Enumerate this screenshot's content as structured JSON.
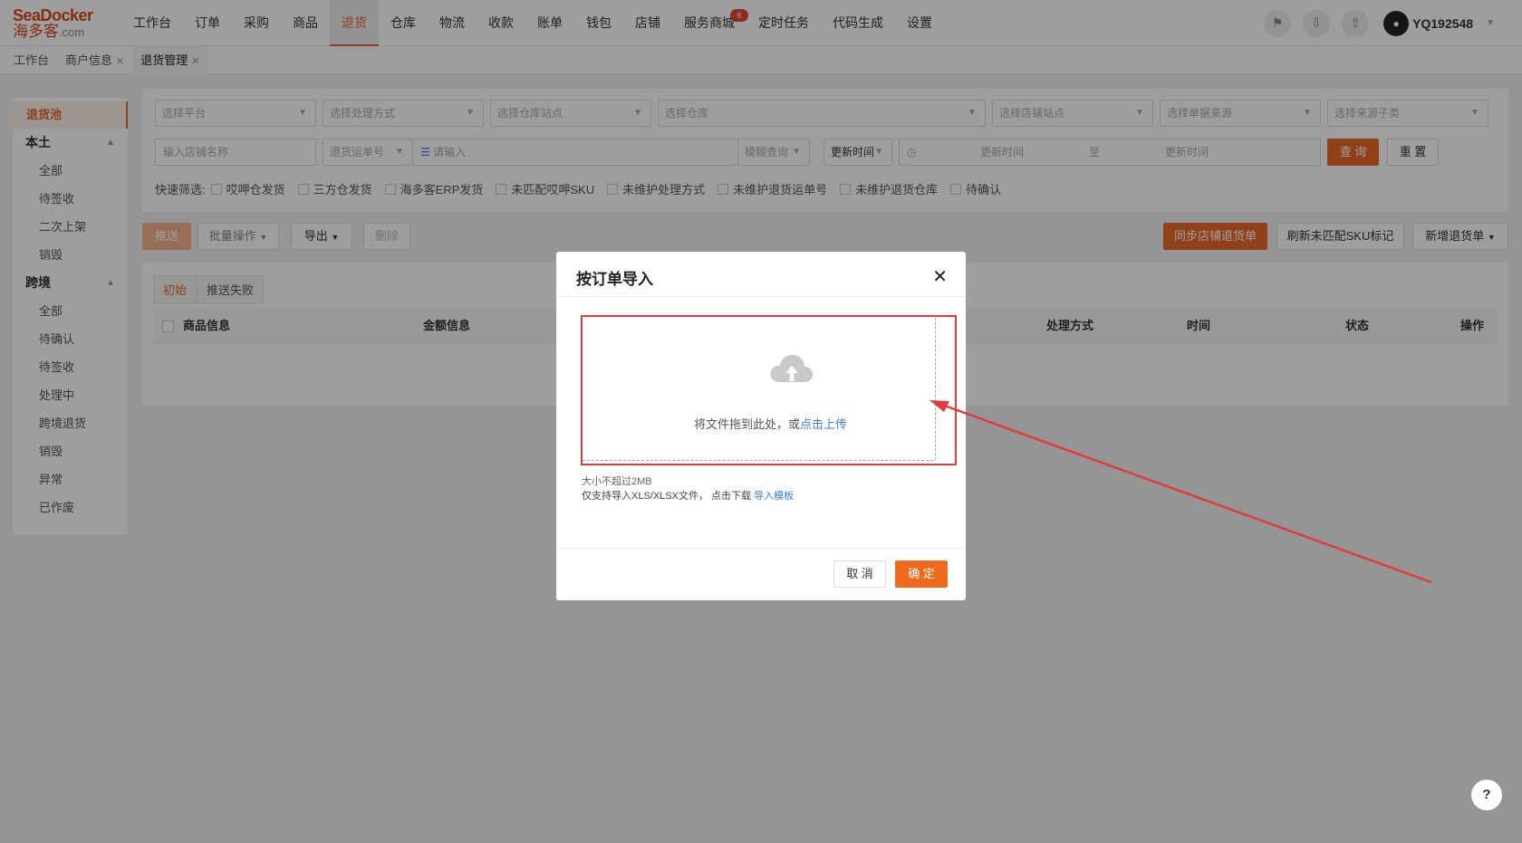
{
  "header": {
    "logo_top": "SeaDocker",
    "logo_bottom": "海多客",
    "logo_domain": ".com",
    "nav": [
      "工作台",
      "订单",
      "采购",
      "商品",
      "退货",
      "仓库",
      "物流",
      "收款",
      "账单",
      "钱包",
      "店铺",
      "服务商城",
      "定时任务",
      "代码生成",
      "设置"
    ],
    "active_nav": "退货",
    "badge_text": "6",
    "username": "YQ192548"
  },
  "tabs": {
    "items": [
      "工作台",
      "商户信息",
      "退货管理"
    ]
  },
  "sidebar": {
    "active": "退货池",
    "group1": "本土",
    "group1_items": [
      "全部",
      "待签收",
      "二次上架",
      "销毁"
    ],
    "group2": "跨境",
    "group2_items": [
      "全部",
      "待确认",
      "待签收",
      "处理中",
      "跨境退货",
      "销毁",
      "异常",
      "已作废"
    ]
  },
  "filters": {
    "sel_platform": "选择平台",
    "sel_process": "选择处理方式",
    "sel_wh_site": "选择仓库站点",
    "sel_wh": "选择仓库",
    "sel_store_site": "选择店铺站点",
    "sel_source": "选择单据来源",
    "sel_source_sub": "选择来源子类",
    "store_name": "输入店铺名称",
    "return_no": "退货运单号",
    "please_input": "请输入",
    "fuzzy": "模糊查询",
    "update_time": "更新时间",
    "start_time": "更新时间",
    "to": "至",
    "end_time": "更新时间",
    "search": "查 询",
    "reset": "重 置",
    "quick_label": "快速筛选:",
    "quick_items": [
      "哎呷仓发货",
      "三方仓发货",
      "海多客ERP发货",
      "未匹配哎呷SKU",
      "未维护处理方式",
      "未维护退货运单号",
      "未维护退货仓库",
      "待确认"
    ]
  },
  "toolbar": {
    "push": "推送",
    "batch": "批量操作",
    "export": "导出",
    "delete": "删除",
    "sync": "同步店铺退货单",
    "refresh": "刷新未匹配SKU标记",
    "new": "新增退货单"
  },
  "table": {
    "tab_initial": "初始",
    "tab_failed": "推送失败",
    "headers": [
      "商品信息",
      "金额信息",
      "处理方式",
      "时间",
      "状态",
      "操作"
    ]
  },
  "modal": {
    "title": "按订单导入",
    "drop_text": "将文件拖到此处，或",
    "drop_link": "点击上传",
    "hint_size": "大小不超过2MB",
    "hint_type": "仅支持导入XLS/XLSX文件，  点击下载",
    "hint_link": "导入模板",
    "cancel": "取 消",
    "ok": "确 定"
  },
  "help": "?",
  "colors": {
    "accent": "#e8692a",
    "link": "#3a7ee8",
    "annotation": "#e23b3b"
  }
}
